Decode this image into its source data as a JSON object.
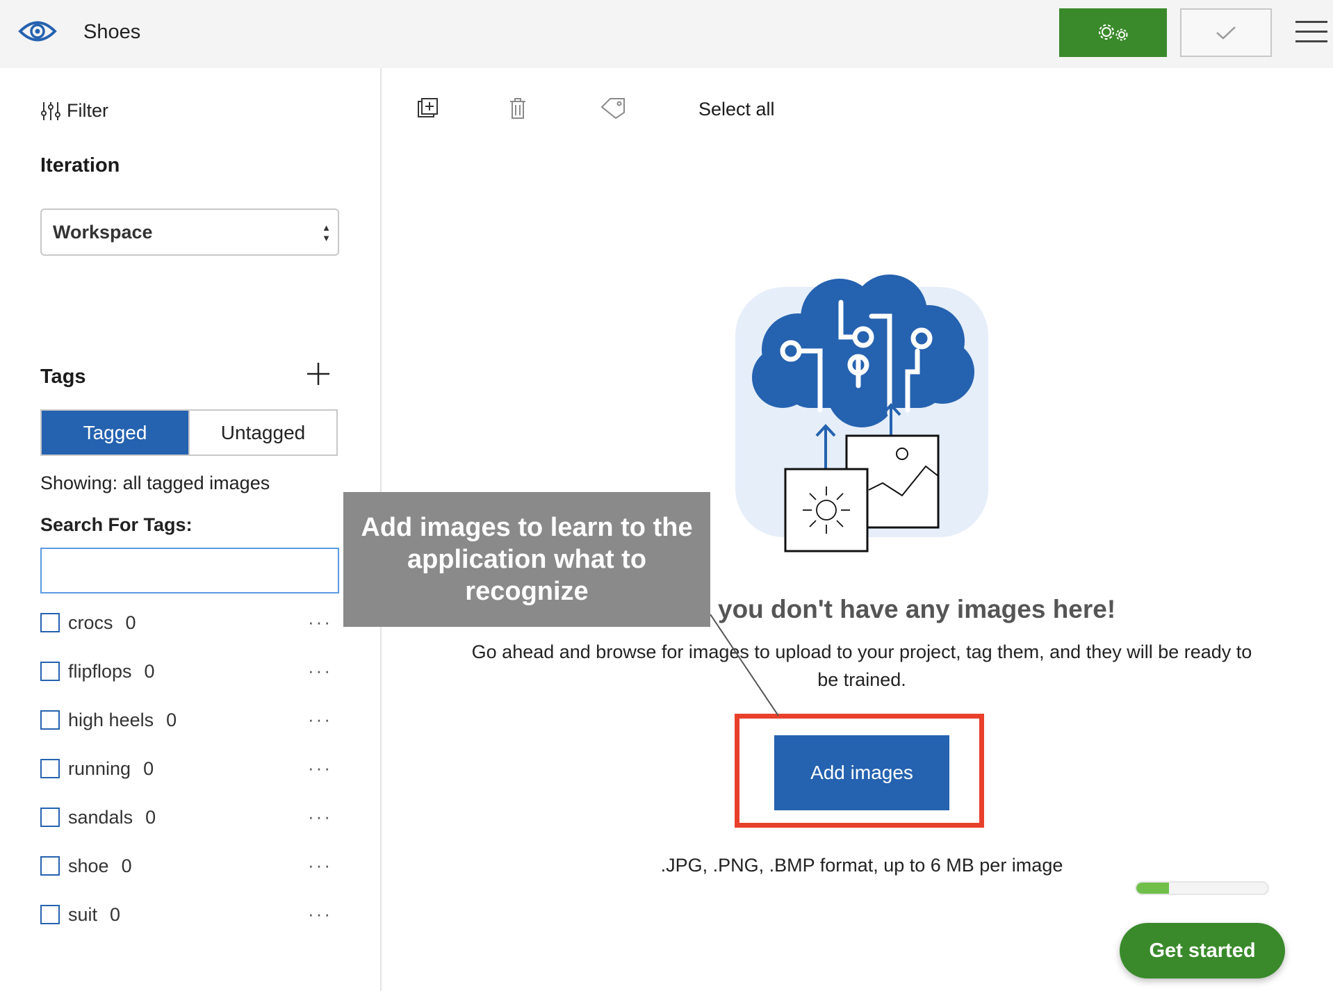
{
  "app": {
    "title": "Shoes"
  },
  "header": {
    "train_icon": "gears-icon",
    "check_icon": "check-icon",
    "menu_icon": "hamburger-icon"
  },
  "sidebar": {
    "filter_label": "Filter",
    "iteration_heading": "Iteration",
    "iteration_value": "Workspace",
    "tags_heading": "Tags",
    "tabs": {
      "tagged": "Tagged",
      "untagged": "Untagged"
    },
    "showing": "Showing: all tagged images",
    "search_label": "Search For Tags:",
    "search_value": "",
    "tags": [
      {
        "name": "crocs",
        "count": "0"
      },
      {
        "name": "flipflops",
        "count": "0"
      },
      {
        "name": "high heels",
        "count": "0"
      },
      {
        "name": "running",
        "count": "0"
      },
      {
        "name": "sandals",
        "count": "0"
      },
      {
        "name": "shoe",
        "count": "0"
      },
      {
        "name": "suit",
        "count": "0"
      }
    ],
    "more_label": "···"
  },
  "toolbar": {
    "select_all": "Select all"
  },
  "main": {
    "headline": "you don't have any images here!",
    "description": "Go ahead and browse for images to upload to your project, tag them, and they will be ready to be trained.",
    "add_button": "Add images",
    "formats": ".JPG, .PNG, .BMP format, up to 6 MB per image",
    "progress_fraction": 0.25,
    "get_started": "Get started"
  },
  "callout": {
    "text": "Add images to learn to the application what to recognize"
  },
  "colors": {
    "accent_blue": "#2562b0",
    "green": "#3a8a2b",
    "highlight": "#e8402b",
    "callout_bg": "#8a8a8a"
  }
}
